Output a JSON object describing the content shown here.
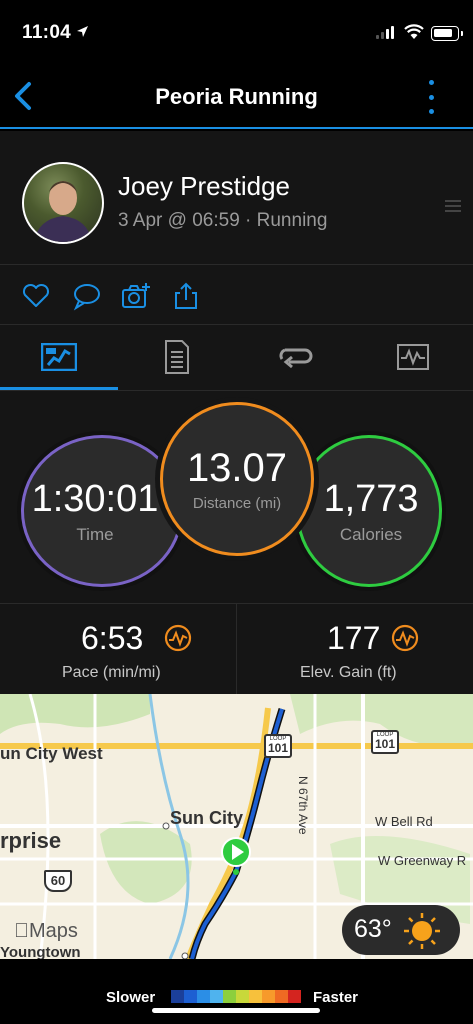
{
  "status_bar": {
    "time": "11:04"
  },
  "nav": {
    "title": "Peoria Running"
  },
  "profile": {
    "name": "Joey Prestidge",
    "subtitle": "3 Apr @ 06:59 · Running"
  },
  "actions": [
    "heart-icon",
    "comment-icon",
    "camera-icon",
    "share-icon"
  ],
  "tabs": [
    {
      "icon": "overview-map-icon",
      "active": true
    },
    {
      "icon": "details-list-icon",
      "active": false
    },
    {
      "icon": "laps-icon",
      "active": false
    },
    {
      "icon": "charts-icon",
      "active": false
    }
  ],
  "stats": {
    "time": {
      "value": "1:30:01",
      "label": "Time",
      "color": "#7a63c6"
    },
    "distance": {
      "value": "13.07",
      "label": "Distance (mi)",
      "color": "#f08c1e"
    },
    "calories": {
      "value": "1,773",
      "label": "Calories",
      "color": "#2ecc40"
    }
  },
  "metrics": {
    "pace": {
      "value": "6:53",
      "label": "Pace (min/mi)"
    },
    "elevation": {
      "value": "177",
      "label": "Elev. Gain (ft)"
    }
  },
  "map": {
    "labels": {
      "sun_city_west": "un City West",
      "sun_city": "Sun City",
      "surprise": "rprise",
      "youngtown": "Youngtown",
      "n67th": "N 67th Ave",
      "bell": "W Bell Rd",
      "greenway": "W Greenway R",
      "loop": "LOOP",
      "r101": "101",
      "r60": "60",
      "maps": "Maps"
    },
    "weather": {
      "temp": "63°",
      "icon": "sun-icon"
    }
  },
  "legend": {
    "slower": "Slower",
    "faster": "Faster",
    "colors": [
      "#1b3f9a",
      "#1d5fd2",
      "#2b8ee6",
      "#4fb3ee",
      "#8ccf3d",
      "#c8d83a",
      "#f7c13c",
      "#f79a2b",
      "#ef6a23",
      "#d4241f"
    ]
  }
}
